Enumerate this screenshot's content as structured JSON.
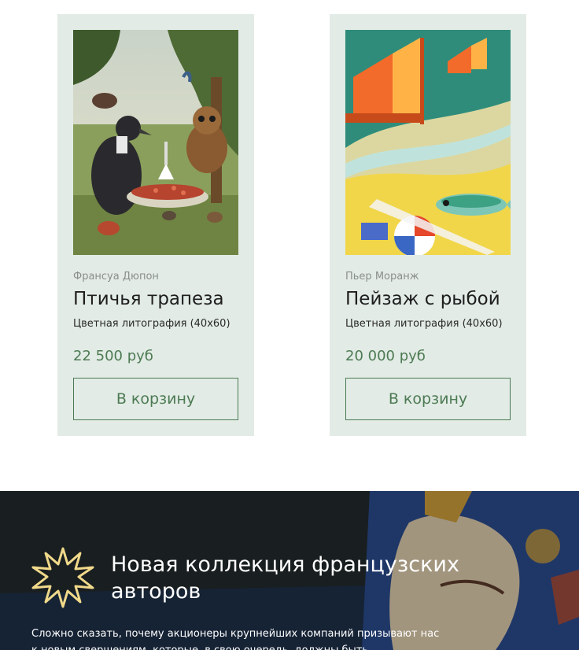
{
  "products": [
    {
      "artist": "Франсуа Дюпон",
      "title": "Птичья трапеза",
      "spec": "Цветная литография (40x60)",
      "price": "22 500 руб",
      "button_label": "В корзину",
      "image_icon": "birds-feast-illustration"
    },
    {
      "artist": "Пьер Моранж",
      "title": "Пейзаж с рыбой",
      "spec": "Цветная литография (40x60)",
      "price": "20 000 руб",
      "button_label": "В корзину",
      "image_icon": "landscape-with-fish-illustration"
    }
  ],
  "banner": {
    "title": "Новая коллекция французских авторов",
    "text": "Сложно сказать, почему акционеры крупнейших компаний призывают нас к новым свершениям, которые, в свою очередь, должны быть заблокированы в",
    "icon": "star-icon"
  },
  "colors": {
    "card_bg": "#e2ebe5",
    "accent": "#4c7a53",
    "muted": "#8a8f8a",
    "banner_bg": "#1c2125",
    "star": "#f0d98a"
  }
}
